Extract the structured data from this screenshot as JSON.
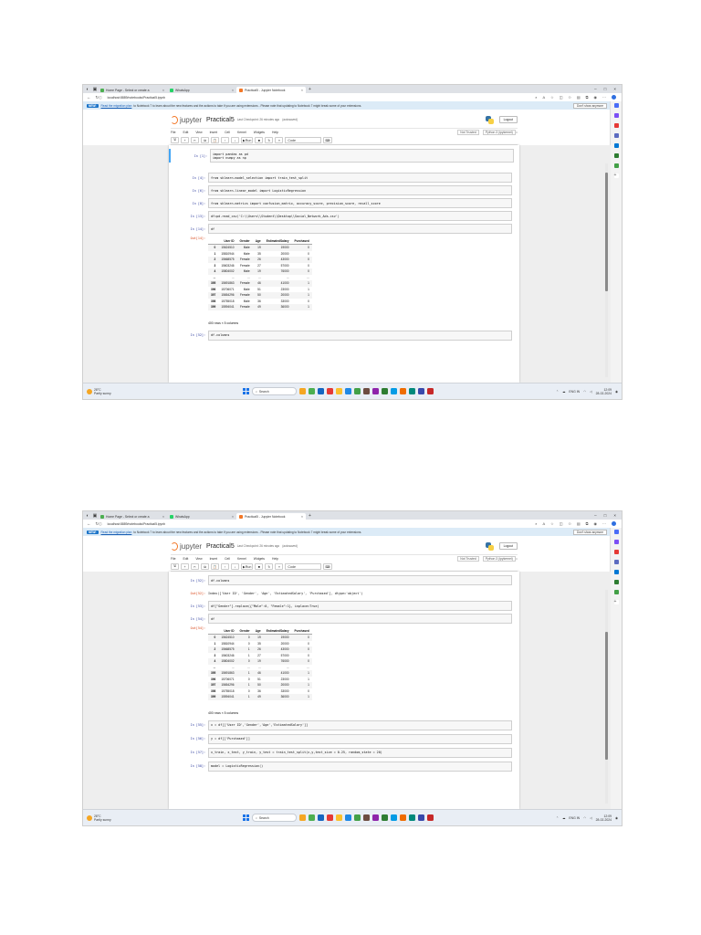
{
  "browser": {
    "tabs": [
      {
        "label": "Home Page - Select or create a",
        "active": false,
        "color": "#4caf50"
      },
      {
        "label": "WhatsApp",
        "active": false,
        "color": "#25d366"
      },
      {
        "label": "Practical5 - Jupyter Notebook",
        "active": true,
        "color": "#f37726"
      }
    ],
    "url": "localhost:8889/notebooks/Practical5.ipynb"
  },
  "notice": {
    "badge": "NEW!",
    "link": "Read the migration plan",
    "text": "to Notebook 7 to learn about the new features and the actions to take if you are using extensions - Please note that updating to Notebook 7 might break some of your extensions.",
    "dismiss": "Don't show anymore"
  },
  "jupyter": {
    "brand": "jupyter",
    "notebook_name": "Practical5",
    "checkpoint": "Last Checkpoint: 26 minutes ago",
    "autosave": "(autosaved)",
    "logout": "Logout",
    "menu": [
      "File",
      "Edit",
      "View",
      "Insert",
      "Cell",
      "Kernel",
      "Widgets",
      "Help"
    ],
    "trusted": "Not Trusted",
    "kernel": "Python 3 (ipykernel)",
    "toolbar": {
      "run": "Run",
      "cell_type": "Code"
    }
  },
  "table_header": [
    "",
    "User ID",
    "Gender",
    "Age",
    "EstimatedSalary",
    "Purchased"
  ],
  "shot1": {
    "cells": [
      {
        "prompt": "In [1]:",
        "lines": [
          "import pandas as pd",
          "import numpy as np"
        ]
      },
      {
        "prompt": "In [4]:",
        "lines": [
          "from sklearn.model_selection import train_test_split"
        ]
      },
      {
        "prompt": "In [6]:",
        "lines": [
          "from sklearn.linear_model import LogisticRegression"
        ]
      },
      {
        "prompt": "In [8]:",
        "lines": [
          "from sklearn.metrics import confusion_matrix, accuracy_score, precision_score, recall_score"
        ]
      },
      {
        "prompt": "In [13]:",
        "lines": [
          "df=pd.read_csv('C:\\\\Users\\\\Student\\\\Desktop\\\\Social_Network_Ads.csv')"
        ]
      },
      {
        "prompt": "In [14]:",
        "lines": [
          "df"
        ]
      }
    ],
    "out_prompt": "Out[14]:",
    "rows": [
      [
        "0",
        "15624510",
        "Male",
        "19",
        "19000",
        "0"
      ],
      [
        "1",
        "15810944",
        "Male",
        "35",
        "20000",
        "0"
      ],
      [
        "2",
        "15668575",
        "Female",
        "26",
        "43000",
        "0"
      ],
      [
        "3",
        "15603246",
        "Female",
        "27",
        "57000",
        "0"
      ],
      [
        "4",
        "15804002",
        "Male",
        "19",
        "76000",
        "0"
      ],
      [
        "...",
        "...",
        "...",
        "...",
        "...",
        "..."
      ],
      [
        "395",
        "15691863",
        "Female",
        "46",
        "41000",
        "1"
      ],
      [
        "396",
        "15706071",
        "Male",
        "51",
        "23000",
        "1"
      ],
      [
        "397",
        "15654296",
        "Female",
        "50",
        "20000",
        "1"
      ],
      [
        "398",
        "15755018",
        "Male",
        "36",
        "33000",
        "0"
      ],
      [
        "399",
        "15594041",
        "Female",
        "49",
        "36000",
        "1"
      ]
    ],
    "shape": "400 rows × 5 columns",
    "last_cell": {
      "prompt": "In [52]:",
      "lines": [
        "df.columns"
      ]
    }
  },
  "shot2": {
    "cells": [
      {
        "prompt": "In [52]:",
        "lines": [
          "df.columns"
        ]
      },
      {
        "prompt": "Out[52]:",
        "output": true,
        "lines": [
          "Index(['User ID', 'Gender', 'Age', 'EstimatedSalary', 'Purchased'], dtype='object')"
        ]
      },
      {
        "prompt": "In [53]:",
        "lines": [
          "df[\"Gender\"].replace({\"Male\":0, \"Female\":1}, inplace=True)"
        ]
      },
      {
        "prompt": "In [54]:",
        "lines": [
          "df"
        ]
      }
    ],
    "out_prompt": "Out[54]:",
    "rows": [
      [
        "0",
        "15624510",
        "0",
        "19",
        "19000",
        "0"
      ],
      [
        "1",
        "15810944",
        "0",
        "35",
        "20000",
        "0"
      ],
      [
        "2",
        "15668575",
        "1",
        "26",
        "43000",
        "0"
      ],
      [
        "3",
        "15603246",
        "1",
        "27",
        "57000",
        "0"
      ],
      [
        "4",
        "15804002",
        "0",
        "19",
        "76000",
        "0"
      ],
      [
        "...",
        "...",
        "...",
        "...",
        "...",
        "..."
      ],
      [
        "395",
        "15691863",
        "1",
        "46",
        "41000",
        "1"
      ],
      [
        "396",
        "15706071",
        "0",
        "51",
        "23000",
        "1"
      ],
      [
        "397",
        "15654296",
        "1",
        "50",
        "20000",
        "1"
      ],
      [
        "398",
        "15755018",
        "0",
        "36",
        "33000",
        "0"
      ],
      [
        "399",
        "15594041",
        "1",
        "49",
        "36000",
        "1"
      ]
    ],
    "shape": "400 rows × 5 columns",
    "after_cells": [
      {
        "prompt": "In [55]:",
        "lines": [
          "x = df[['User ID','Gender','Age','EstimatedSalary']]"
        ]
      },
      {
        "prompt": "In [56]:",
        "lines": [
          "y = df[['Purchased']]"
        ]
      },
      {
        "prompt": "In [57]:",
        "lines": [
          "x_train, x_test, y_train, y_test = train_test_split(x,y,test_size = 0.25, random_state = 20)"
        ]
      },
      {
        "prompt": "In [58]:",
        "lines": [
          "model = LogisticRegression()"
        ]
      }
    ]
  },
  "taskbar": {
    "weather_temp": "28°C",
    "weather_desc": "Partly sunny",
    "search": "Search",
    "lang": "ENG IN",
    "time": "12:09",
    "date": "28-02-2024",
    "icon_colors": [
      "#f5a623",
      "#4caf50",
      "#1565c0",
      "#e53935",
      "#fbc02d",
      "#1e88e5",
      "#43a047",
      "#6d4c41",
      "#8e24aa",
      "#2e7d32",
      "#039be5",
      "#ef6c00",
      "#00897b",
      "#3949ab",
      "#c62828"
    ]
  }
}
